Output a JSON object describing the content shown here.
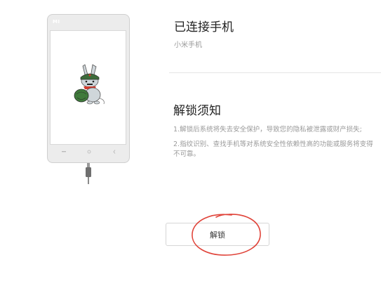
{
  "phone": {
    "brand": "MI",
    "nav_icons": [
      "menu-icon",
      "home-icon",
      "back-icon"
    ],
    "mascot": "mi-bunny-mascot"
  },
  "device": {
    "title": "已连接手机",
    "model": "小米手机"
  },
  "notice": {
    "title": "解锁须知",
    "items": [
      "1.解锁后系统将失去安全保护，导致您的隐私被泄露或财产损失;",
      "2.指纹识别、查找手机等对系统安全性依赖性高的功能或服务将变得不可靠。"
    ]
  },
  "actions": {
    "unlock_label": "解锁"
  },
  "colors": {
    "annotation": "#e0443a",
    "phone_body": "#ececec",
    "button_border": "#d6d6d6"
  }
}
